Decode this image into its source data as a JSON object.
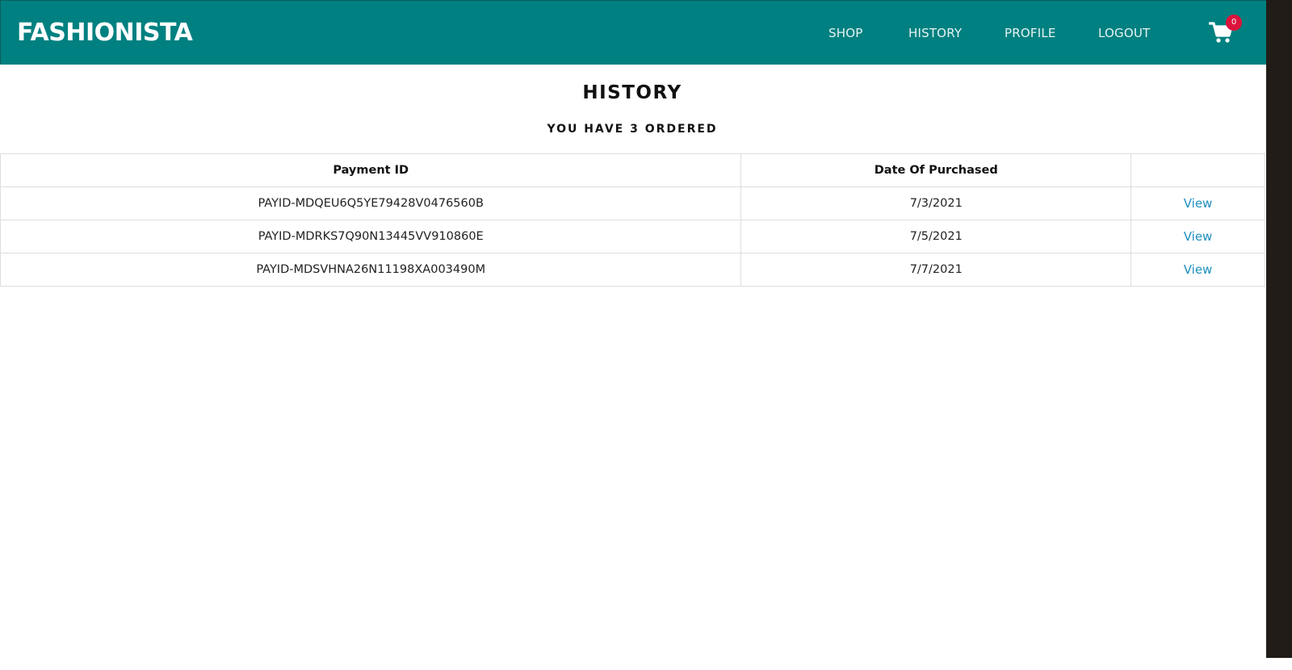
{
  "navbar": {
    "brand": "FASHIONISTA",
    "links": [
      {
        "label": "SHOP"
      },
      {
        "label": "HISTORY"
      },
      {
        "label": "PROFILE"
      },
      {
        "label": "LOGOUT"
      }
    ],
    "cart_icon": "shopping-cart-icon",
    "cart_count": "0"
  },
  "page": {
    "title": "HISTORY",
    "subtitle": "YOU HAVE 3 ORDERED"
  },
  "table": {
    "headers": [
      "Payment ID",
      "Date Of Purchased",
      ""
    ],
    "rows": [
      {
        "payment_id": "PAYID-MDQEU6Q5YE79428V0476560B",
        "date": "7/3/2021",
        "action": "View"
      },
      {
        "payment_id": "PAYID-MDRKS7Q90N13445VV910860E",
        "date": "7/5/2021",
        "action": "View"
      },
      {
        "payment_id": "PAYID-MDSVHNA26N11198XA003490M",
        "date": "7/7/2021",
        "action": "View"
      }
    ]
  },
  "colors": {
    "navbar_bg": "#008080",
    "badge_bg": "#dc143c",
    "link": "#1e8fbf"
  }
}
